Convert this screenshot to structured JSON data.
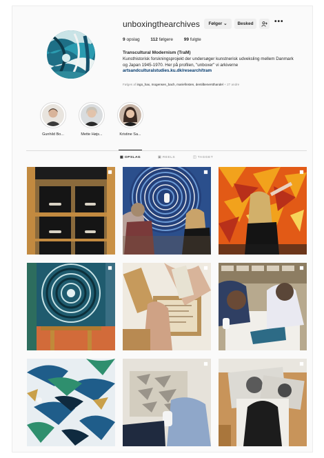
{
  "profile": {
    "username": "unboxingthearchives",
    "follow_label": "Følger ⌄",
    "message_label": "Besked",
    "add_user_icon": "add-user-icon",
    "more_label": "•••",
    "stats": {
      "posts_count": "9",
      "posts_label": "opslag",
      "followers_count": "112",
      "followers_label": "følgere",
      "following_count": "99",
      "following_label": "fulgte"
    },
    "full_name": "Transcultural Modernism (TraM)",
    "bio_line": "Kunsthistorisk forskningsprojekt der undersøger kunstnerisk udveksling mellem Danmark og Japan 1945-1970. Her på profilen, \"unboxer\" vi arkiverne",
    "link": "artsandculturalstudies.ku.dk/research/tram",
    "followed_prefix": "Følges af",
    "followed_names": "ingo_hax, mogensen_bach, mariefinsten, dentilbenersthandel",
    "followed_suffix": "+ 27 andre"
  },
  "highlights": [
    {
      "label": "Gunhild Bo..."
    },
    {
      "label": "Mette Højs..."
    },
    {
      "label": "Kristine Sa..."
    }
  ],
  "tabs": [
    {
      "label": "OPSLAG",
      "icon": "grid-icon"
    },
    {
      "label": "REELS",
      "icon": "reels-icon"
    },
    {
      "label": "TAGGET",
      "icon": "tagged-icon"
    }
  ],
  "colors": {
    "background": "#fafafa",
    "text": "#262626",
    "muted": "#8e8e8e",
    "link": "#00376b",
    "button": "#efefef"
  }
}
